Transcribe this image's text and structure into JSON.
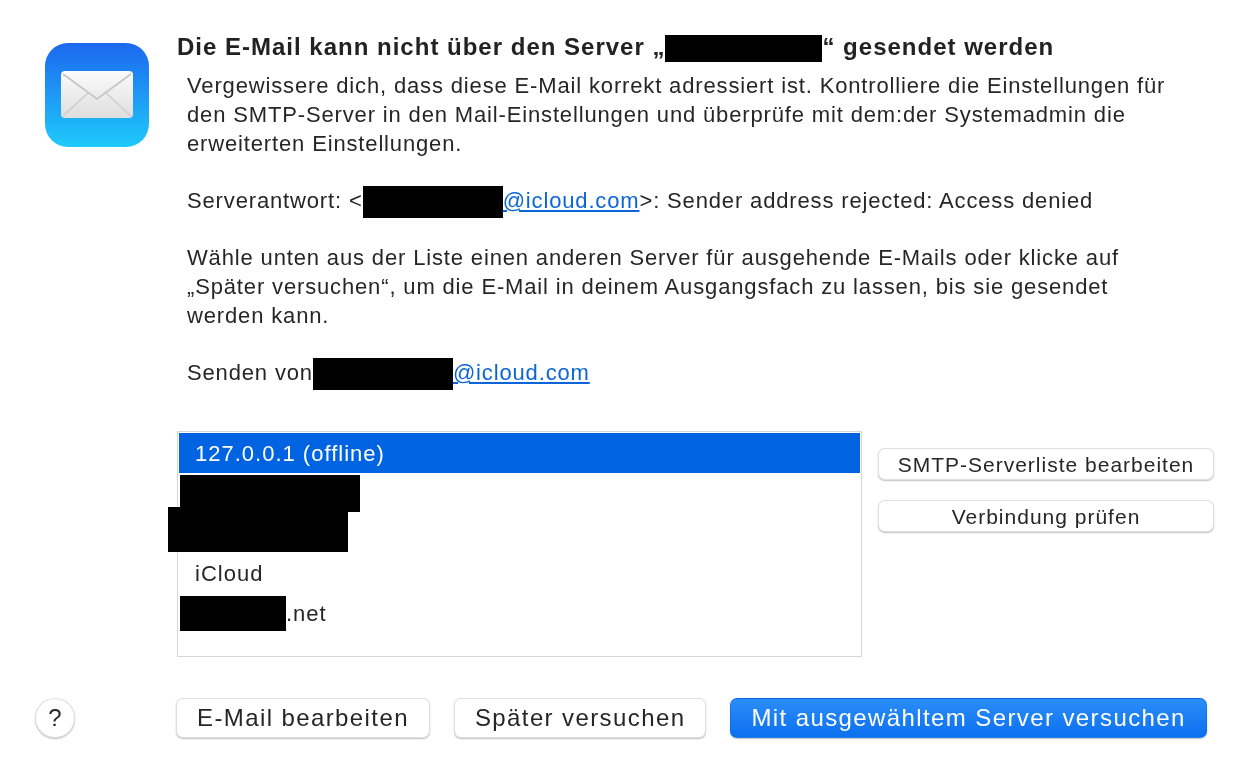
{
  "dialog": {
    "title": [
      {
        "kind": "text",
        "text": "Die E-Mail kann nicht über den Server „"
      },
      {
        "kind": "redaction"
      },
      {
        "kind": "text",
        "text": "“ gesendet werden"
      }
    ],
    "paragraphs": [
      [
        {
          "kind": "text",
          "text": "Vergewissere dich, dass diese E-Mail korrekt adressiert ist. Kontrolliere die Einstellungen für den SMTP-Server in den Mail-Einstellungen und überprüfe mit dem:der Systemadmin die erweiterten Einstellungen."
        }
      ],
      [
        {
          "kind": "text",
          "text": "Serverantwort: <"
        },
        {
          "kind": "redaction"
        },
        {
          "kind": "link",
          "text": "@icloud.com"
        },
        {
          "kind": "text",
          "text": ">: Sender address rejected: Access denied"
        }
      ],
      [
        {
          "kind": "text",
          "text": "Wähle unten aus der Liste einen anderen Server für ausgehende E-Mails oder klicke auf „Später versuchen“, um die E-Mail in deinem Ausgangsfach zu lassen, bis sie gesendet werden kann."
        }
      ],
      [
        {
          "kind": "text",
          "text": "Senden von"
        },
        {
          "kind": "redaction"
        },
        {
          "kind": "link",
          "text": "@icloud.com"
        }
      ]
    ]
  },
  "server_list": {
    "items": [
      {
        "selected": true,
        "segments": [
          {
            "kind": "text",
            "text": "127.0.0.1 (offline)"
          }
        ]
      },
      {
        "selected": false,
        "segments": [
          {
            "kind": "redaction"
          }
        ]
      },
      {
        "selected": false,
        "segments": [
          {
            "kind": "redaction"
          }
        ]
      },
      {
        "selected": false,
        "segments": [
          {
            "kind": "text",
            "text": "iCloud"
          }
        ]
      },
      {
        "selected": false,
        "segments": [
          {
            "kind": "redaction"
          },
          {
            "kind": "text",
            "text": ".net"
          }
        ]
      }
    ]
  },
  "side_buttons": [
    "SMTP-Serverliste bearbeiten",
    "Verbindung prüfen"
  ],
  "help_button": {
    "label": "?"
  },
  "footer_buttons": [
    {
      "label": "E-Mail bearbeiten",
      "kind": "default"
    },
    {
      "label": "Später versuchen",
      "kind": "default"
    },
    {
      "label": "Mit ausgewähltem Server versuchen",
      "kind": "primary"
    }
  ]
}
